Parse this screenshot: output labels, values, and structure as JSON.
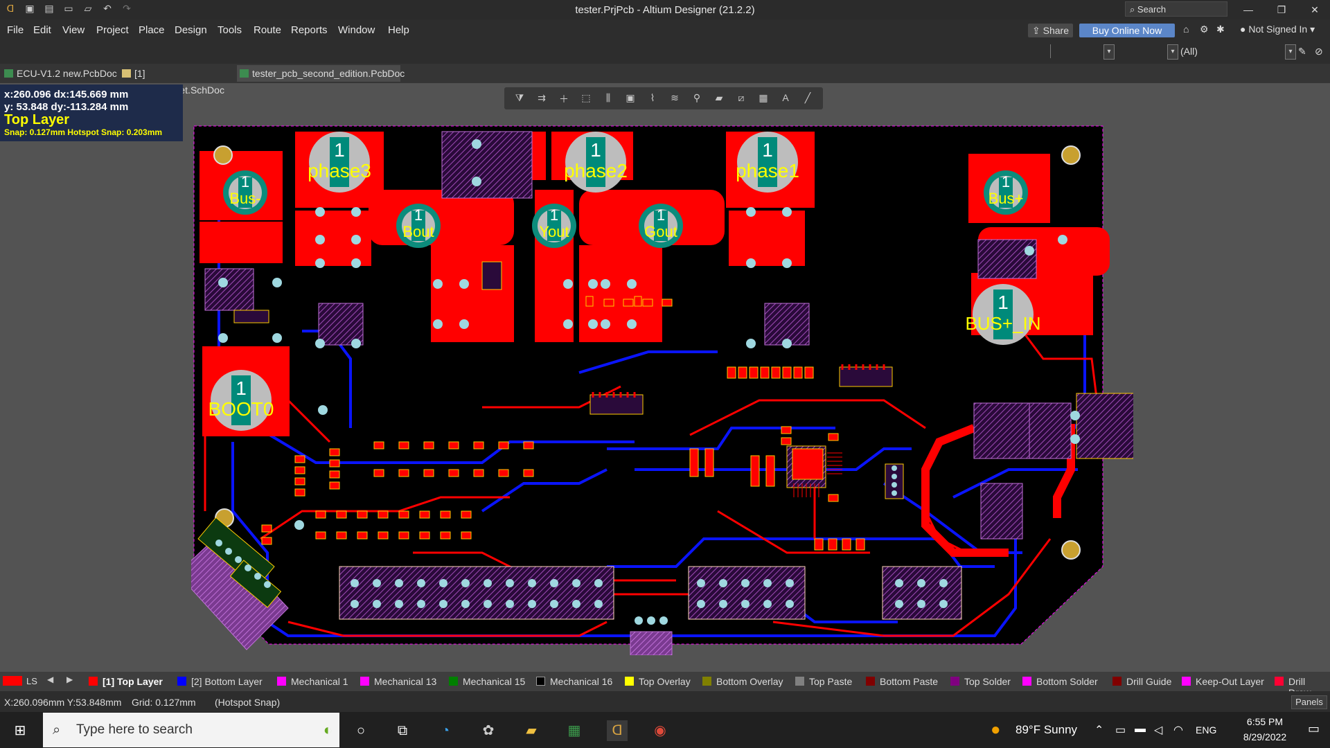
{
  "window": {
    "title": "tester.PrjPcb - Altium Designer (21.2.2)",
    "search_label": "Search"
  },
  "menu": [
    "File",
    "Edit",
    "View",
    "Project",
    "Place",
    "Design",
    "Tools",
    "Route",
    "Reports",
    "Window",
    "Help"
  ],
  "header_right": {
    "share": "Share",
    "buy": "Buy Online Now",
    "account": "Not Signed In",
    "filter_all": "(All)"
  },
  "tabs": [
    {
      "label": "ECU-V1.2 new.PcbDoc",
      "active": false
    },
    {
      "label": "[1] tester_sheet.SchDoc",
      "active": false
    },
    {
      "label": "tester_pcb_second_edition.PcbDoc",
      "active": true
    }
  ],
  "coords": {
    "line1": "x:260.096   dx:145.669  mm",
    "line2": "y: 53.848   dy:-113.284 mm",
    "layer": "Top Layer",
    "snap": "Snap: 0.127mm Hotspot Snap: 0.203mm"
  },
  "board_labels": {
    "bus_minus": "Bus-",
    "phase3": "phase3",
    "phase2": "phase2",
    "phase1": "phase1",
    "bus_plus": "Bus+",
    "bout": "Bout",
    "yout": "Yout",
    "gout": "Gout",
    "bus_plus_in": "BUS+_IN",
    "boot0": "BOOT0",
    "one": "1"
  },
  "layers": {
    "ls": "LS",
    "items": [
      {
        "label": "[1] Top Layer",
        "color": "#ff0000",
        "active": true
      },
      {
        "label": "[2] Bottom Layer",
        "color": "#0000ff",
        "active": false
      },
      {
        "label": "Mechanical 1",
        "color": "#ff00ff",
        "active": false
      },
      {
        "label": "Mechanical 13",
        "color": "#ff00ff",
        "active": false
      },
      {
        "label": "Mechanical 15",
        "color": "#008000",
        "active": false
      },
      {
        "label": "Mechanical 16",
        "color": "#000000",
        "active": false
      },
      {
        "label": "Top Overlay",
        "color": "#ffff00",
        "active": false
      },
      {
        "label": "Bottom Overlay",
        "color": "#808000",
        "active": false
      },
      {
        "label": "Top Paste",
        "color": "#808080",
        "active": false
      },
      {
        "label": "Bottom Paste",
        "color": "#800000",
        "active": false
      },
      {
        "label": "Top Solder",
        "color": "#800080",
        "active": false
      },
      {
        "label": "Bottom Solder",
        "color": "#ff00ff",
        "active": false
      },
      {
        "label": "Drill Guide",
        "color": "#800000",
        "active": false
      },
      {
        "label": "Keep-Out Layer",
        "color": "#ff00ff",
        "active": false
      },
      {
        "label": "Drill Draw",
        "color": "#ff0033",
        "active": false
      }
    ]
  },
  "status": {
    "coords": "X:260.096mm Y:53.848mm",
    "grid": "Grid: 0.127mm",
    "snap": "(Hotspot Snap)",
    "panels": "Panels"
  },
  "taskbar": {
    "search_placeholder": "Type here to search",
    "weather": "89°F  Sunny",
    "lang": "ENG",
    "time": "6:55 PM",
    "date": "8/29/2022"
  }
}
